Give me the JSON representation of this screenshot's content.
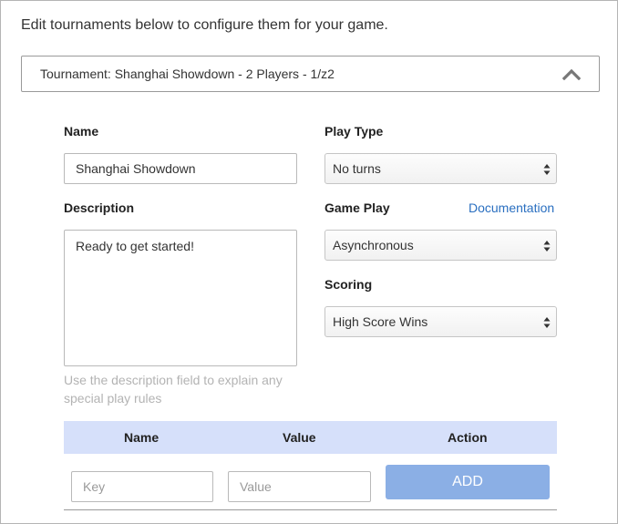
{
  "intro_text": "Edit tournaments below to configure them for your game.",
  "tournament": {
    "header_label": "Tournament: Shanghai Showdown - 2 Players - 1/z2",
    "expanded": true
  },
  "form": {
    "name_label": "Name",
    "name_value": "Shanghai Showdown",
    "description_label": "Description",
    "description_value": "Ready to get started!",
    "description_help": "Use the description field to explain any special play rules",
    "play_type_label": "Play Type",
    "play_type_value": "No turns",
    "game_play_label": "Game Play",
    "documentation_link": "Documentation",
    "game_play_value": "Asynchronous",
    "scoring_label": "Scoring",
    "scoring_value": "High Score Wins"
  },
  "params_table": {
    "columns": [
      "Name",
      "Value",
      "Action"
    ],
    "key_placeholder": "Key",
    "value_placeholder": "Value",
    "add_label": "ADD"
  },
  "colors": {
    "link": "#2a6fc0",
    "table_header_bg": "#d6e0fa",
    "add_button_bg": "#8bafe5",
    "help_text": "#b3b3b3"
  }
}
